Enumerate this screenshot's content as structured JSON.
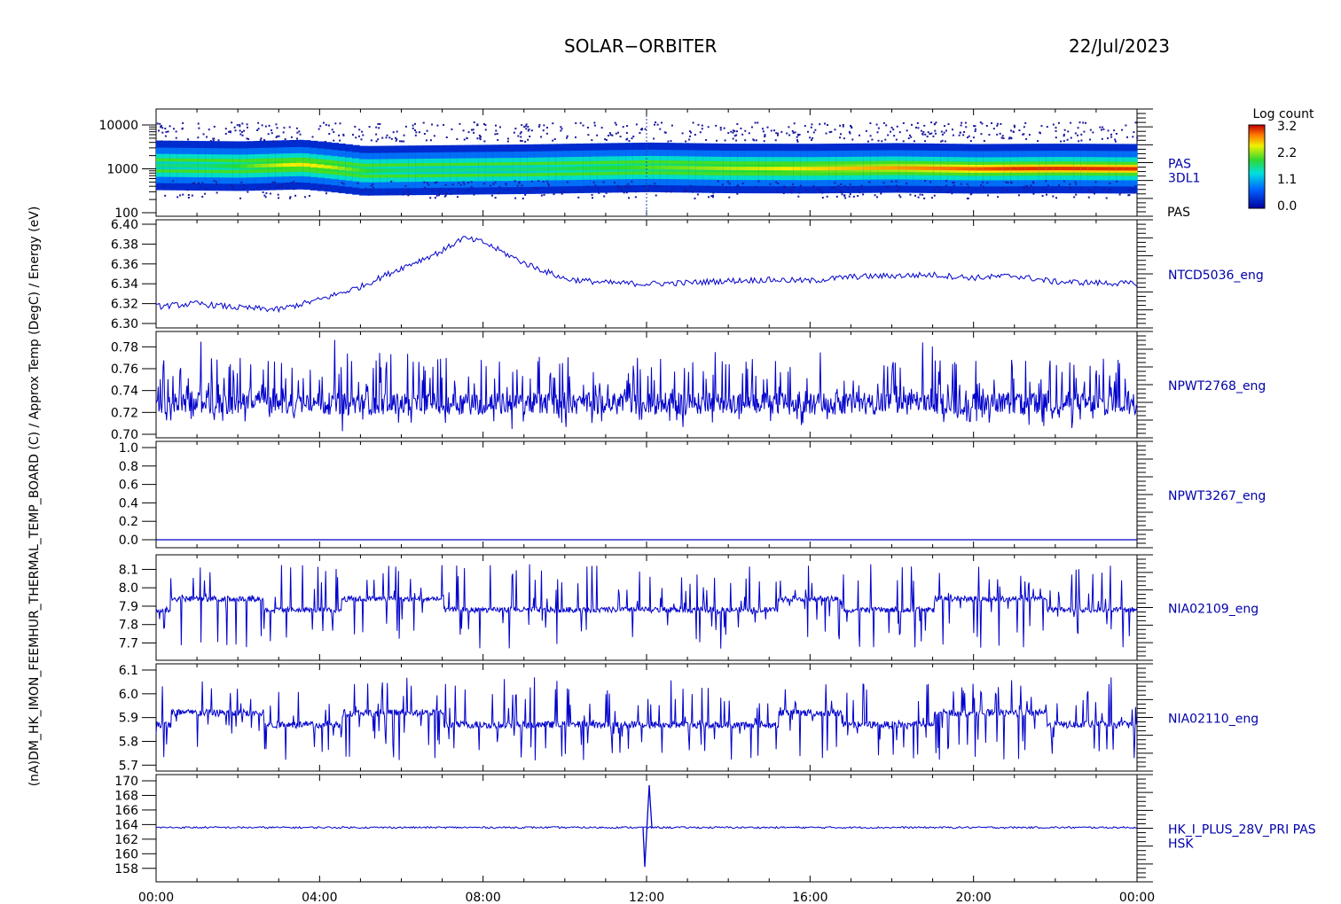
{
  "header": {
    "mission": "SOLAR−ORBITER",
    "date": "22/Jul/2023"
  },
  "colorbar": {
    "title": "Log count",
    "ticks": [
      "3.2",
      "2.2",
      "1.1",
      "0.0"
    ]
  },
  "x_axis": {
    "ticks": [
      "00:00",
      "04:00",
      "08:00",
      "12:00",
      "16:00",
      "20:00",
      "00:00"
    ]
  },
  "y_title_overlap": "(nA)DM_HK_IMON_FEEMHUR_THERMAL_TEMP_BOARD (C) / Approx Temp (DegC) / Energy (eV)",
  "colors": {
    "series": "#0000cc",
    "label": "#0000aa",
    "axis": "#000000"
  },
  "chart_data": [
    {
      "type": "heatmap",
      "label": "PAS",
      "label2": "3DL1",
      "ylabel": "(eV)",
      "yscale": "log",
      "ylim": [
        100,
        15000
      ],
      "y_ticks": [
        "10000",
        "1000",
        "100"
      ],
      "z_range": [
        0.0,
        3.2
      ],
      "x_range_hours": [
        0,
        24
      ],
      "peak_energy_eV": [
        [
          0,
          1200
        ],
        [
          2,
          1150
        ],
        [
          3.5,
          1250
        ],
        [
          5,
          900
        ],
        [
          7.5,
          950
        ],
        [
          9,
          980
        ],
        [
          11,
          1050
        ],
        [
          12,
          1080
        ],
        [
          14,
          1020
        ],
        [
          16,
          1010
        ],
        [
          18,
          1050
        ],
        [
          20,
          1000
        ],
        [
          22,
          1020
        ],
        [
          24,
          1000
        ]
      ]
    },
    {
      "type": "line",
      "label": "NTCD5036_eng",
      "ylim": [
        6.3,
        6.4
      ],
      "y_ticks": [
        "6.40",
        "6.38",
        "6.36",
        "6.34",
        "6.32",
        "6.30"
      ],
      "x_hours": [
        0,
        1,
        2,
        3,
        4,
        5,
        6,
        7,
        7.5,
        8,
        9,
        10,
        11,
        12,
        13,
        14,
        15,
        16,
        17,
        18,
        19,
        20,
        21,
        22,
        23,
        24
      ],
      "values": [
        6.317,
        6.32,
        6.316,
        6.314,
        6.324,
        6.337,
        6.356,
        6.373,
        6.386,
        6.382,
        6.361,
        6.345,
        6.341,
        6.34,
        6.341,
        6.343,
        6.344,
        6.343,
        6.347,
        6.348,
        6.349,
        6.346,
        6.348,
        6.342,
        6.341,
        6.34
      ]
    },
    {
      "type": "line",
      "label": "NPWT2768_eng",
      "ylim": [
        0.7,
        0.79
      ],
      "y_ticks": [
        "0.78",
        "0.76",
        "0.74",
        "0.72",
        "0.70"
      ],
      "baseline": 0.728,
      "noise_range": [
        0.702,
        0.787
      ]
    },
    {
      "type": "line",
      "label": "NPWT3267_eng",
      "ylim": [
        0.0,
        1.0
      ],
      "y_ticks": [
        "1.0",
        "0.8",
        "0.6",
        "0.4",
        "0.2",
        "0.0"
      ],
      "values_constant": 0.0
    },
    {
      "type": "line",
      "label": "NIA02109_eng",
      "ylim": [
        7.63,
        8.16
      ],
      "y_ticks": [
        "8.1",
        "8.0",
        "7.9",
        "7.8",
        "7.7"
      ],
      "baseline_levels": [
        7.88,
        7.94
      ],
      "noise_range": [
        7.67,
        8.13
      ]
    },
    {
      "type": "line",
      "label": "NIA02110_eng",
      "ylim": [
        5.69,
        6.1
      ],
      "y_ticks": [
        "6.1",
        "6.0",
        "5.9",
        "5.8",
        "5.7"
      ],
      "baseline_levels": [
        5.87,
        5.92
      ],
      "noise_range": [
        5.72,
        6.07
      ]
    },
    {
      "type": "line",
      "label": "HK_I_PLUS_28V_PRI PAS",
      "label2": "HSK",
      "ylim": [
        157,
        170
      ],
      "y_ticks": [
        "170",
        "168",
        "166",
        "164",
        "162",
        "160",
        "158"
      ],
      "baseline": 163.6,
      "spike": {
        "x_hours": 12.0,
        "min": 158.2,
        "max": 169.4
      }
    }
  ]
}
